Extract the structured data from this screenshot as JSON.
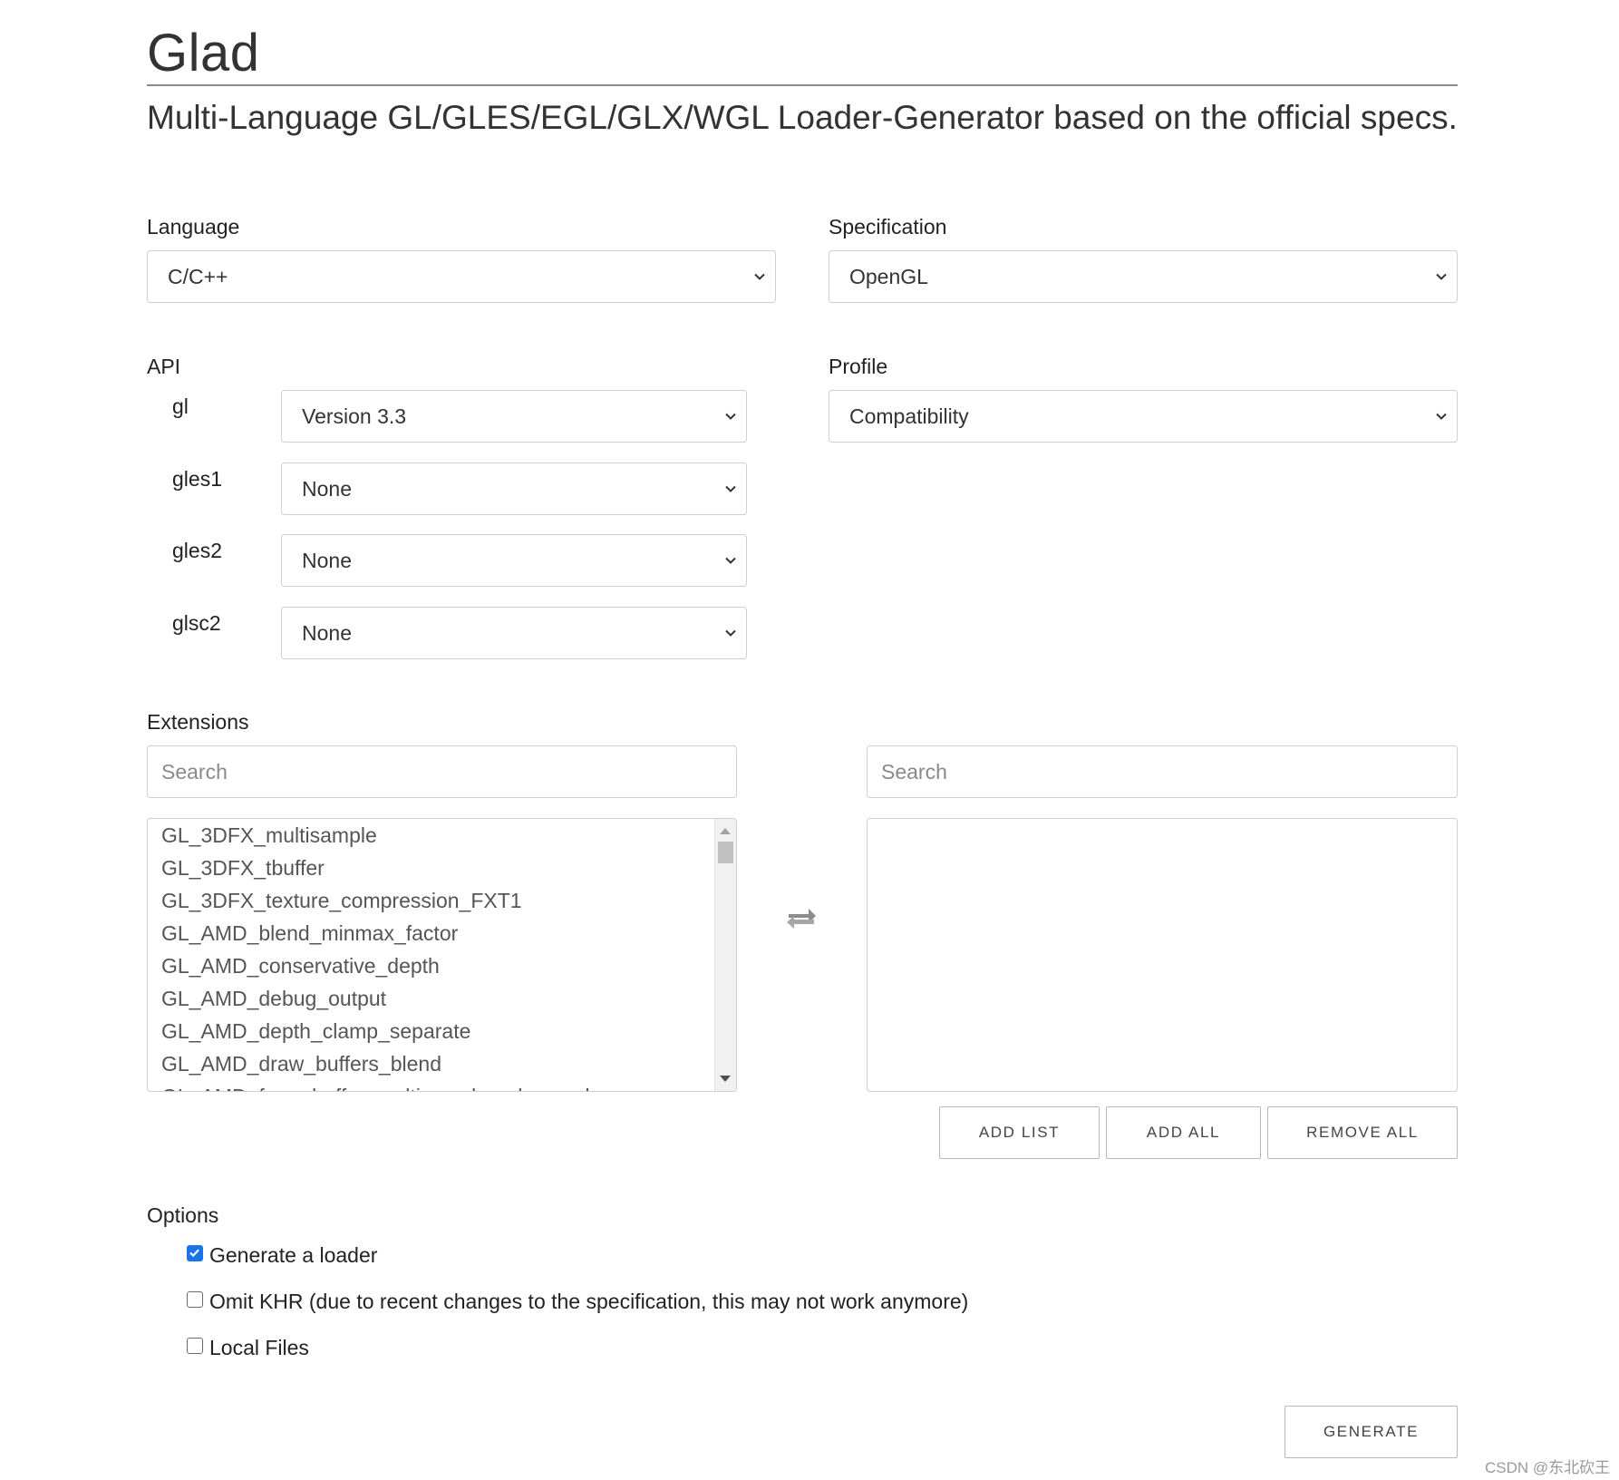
{
  "header": {
    "title": "Glad",
    "subtitle": "Multi-Language GL/GLES/EGL/GLX/WGL Loader-Generator based on the official specs."
  },
  "language": {
    "label": "Language",
    "value": "C/C++"
  },
  "specification": {
    "label": "Specification",
    "value": "OpenGL"
  },
  "api": {
    "label": "API",
    "rows": [
      {
        "name": "gl",
        "value": "Version 3.3"
      },
      {
        "name": "gles1",
        "value": "None"
      },
      {
        "name": "gles2",
        "value": "None"
      },
      {
        "name": "glsc2",
        "value": "None"
      }
    ]
  },
  "profile": {
    "label": "Profile",
    "value": "Compatibility"
  },
  "extensions": {
    "label": "Extensions",
    "left_search_placeholder": "Search",
    "right_search_placeholder": "Search",
    "available": [
      "GL_3DFX_multisample",
      "GL_3DFX_tbuffer",
      "GL_3DFX_texture_compression_FXT1",
      "GL_AMD_blend_minmax_factor",
      "GL_AMD_conservative_depth",
      "GL_AMD_debug_output",
      "GL_AMD_depth_clamp_separate",
      "GL_AMD_draw_buffers_blend",
      "GL_AMD_framebuffer_multisample_advanced"
    ],
    "selected": [],
    "add_list_label": "ADD LIST",
    "add_all_label": "ADD ALL",
    "remove_all_label": "REMOVE ALL",
    "swap_icon": "swap-arrows-icon"
  },
  "options": {
    "label": "Options",
    "items": [
      {
        "label": "Generate a loader",
        "checked": true
      },
      {
        "label": "Omit KHR (due to recent changes to the specification, this may not work anymore)",
        "checked": false
      },
      {
        "label": "Local Files",
        "checked": false
      }
    ]
  },
  "generate_label": "GENERATE",
  "watermark": "CSDN @东北砍王",
  "colors": {
    "accent": "#1a73e8",
    "border": "#cfcfcf",
    "text": "#222222",
    "muted_text": "#555555"
  }
}
